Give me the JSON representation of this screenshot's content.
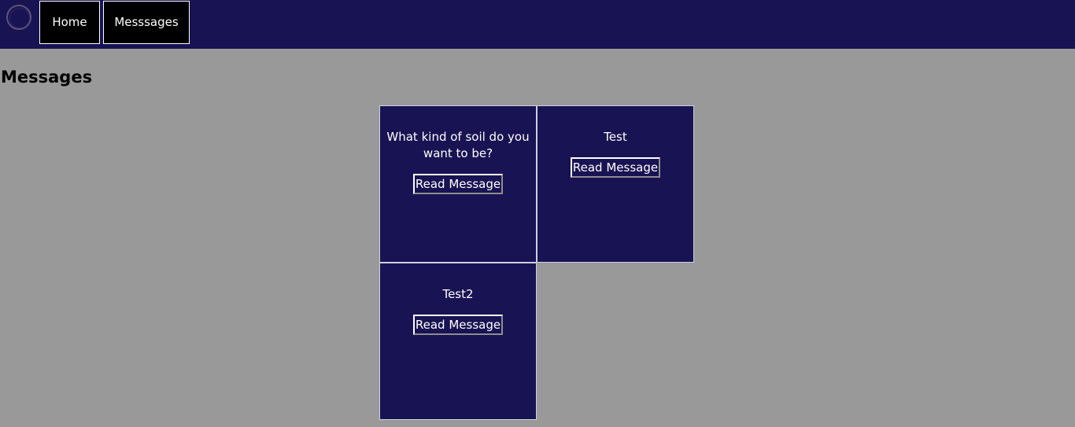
{
  "nav": {
    "logo_icon": "ring-logo-icon",
    "home_label": "Home",
    "messages_label": "Messsages"
  },
  "page": {
    "title": "Messages"
  },
  "messages": [
    {
      "title": "What kind of soil do you want to be?",
      "button_label": "Read Message"
    },
    {
      "title": "Test",
      "button_label": "Read Message"
    },
    {
      "title": "Test2",
      "button_label": "Read Message"
    }
  ],
  "colors": {
    "navbar_bg": "#181352",
    "page_bg": "#999999",
    "card_bg": "#181352",
    "nav_button_bg": "#000000",
    "text_light": "#ffffff"
  }
}
